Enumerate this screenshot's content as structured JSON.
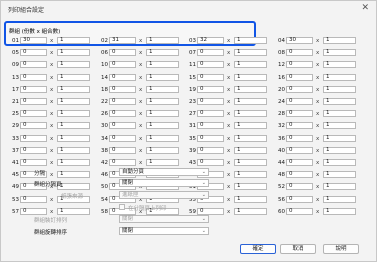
{
  "window": {
    "title": "列印組合設定",
    "close_glyph": "✕"
  },
  "group_header": "群組 (份數 x 組合數)",
  "multiplier": "x",
  "groups": [
    {
      "n": "01",
      "v": "30",
      "c": "1"
    },
    {
      "n": "02",
      "v": "31",
      "c": "1"
    },
    {
      "n": "03",
      "v": "32",
      "c": "1"
    },
    {
      "n": "04",
      "v": "30",
      "c": "1"
    },
    {
      "n": "05",
      "v": "0",
      "c": "1"
    },
    {
      "n": "06",
      "v": "0",
      "c": "1"
    },
    {
      "n": "07",
      "v": "0",
      "c": "1"
    },
    {
      "n": "08",
      "v": "0",
      "c": "1"
    },
    {
      "n": "09",
      "v": "0",
      "c": "1"
    },
    {
      "n": "10",
      "v": "0",
      "c": "1"
    },
    {
      "n": "11",
      "v": "0",
      "c": "1"
    },
    {
      "n": "12",
      "v": "0",
      "c": "1"
    },
    {
      "n": "13",
      "v": "0",
      "c": "1"
    },
    {
      "n": "14",
      "v": "0",
      "c": "1"
    },
    {
      "n": "15",
      "v": "0",
      "c": "1"
    },
    {
      "n": "16",
      "v": "0",
      "c": "1"
    },
    {
      "n": "17",
      "v": "0",
      "c": "1"
    },
    {
      "n": "18",
      "v": "0",
      "c": "1"
    },
    {
      "n": "19",
      "v": "0",
      "c": "1"
    },
    {
      "n": "20",
      "v": "0",
      "c": "1"
    },
    {
      "n": "21",
      "v": "0",
      "c": "1"
    },
    {
      "n": "22",
      "v": "0",
      "c": "1"
    },
    {
      "n": "23",
      "v": "0",
      "c": "1"
    },
    {
      "n": "24",
      "v": "0",
      "c": "1"
    },
    {
      "n": "25",
      "v": "0",
      "c": "1"
    },
    {
      "n": "26",
      "v": "0",
      "c": "1"
    },
    {
      "n": "27",
      "v": "0",
      "c": "1"
    },
    {
      "n": "28",
      "v": "0",
      "c": "1"
    },
    {
      "n": "29",
      "v": "0",
      "c": "1"
    },
    {
      "n": "30",
      "v": "0",
      "c": "1"
    },
    {
      "n": "31",
      "v": "0",
      "c": "1"
    },
    {
      "n": "32",
      "v": "0",
      "c": "1"
    },
    {
      "n": "33",
      "v": "0",
      "c": "1"
    },
    {
      "n": "34",
      "v": "0",
      "c": "1"
    },
    {
      "n": "35",
      "v": "0",
      "c": "1"
    },
    {
      "n": "36",
      "v": "0",
      "c": "1"
    },
    {
      "n": "37",
      "v": "0",
      "c": "1"
    },
    {
      "n": "38",
      "v": "0",
      "c": "1"
    },
    {
      "n": "39",
      "v": "0",
      "c": "1"
    },
    {
      "n": "40",
      "v": "0",
      "c": "1"
    },
    {
      "n": "41",
      "v": "0",
      "c": "1"
    },
    {
      "n": "42",
      "v": "0",
      "c": "1"
    },
    {
      "n": "43",
      "v": "0",
      "c": "1"
    },
    {
      "n": "44",
      "v": "0",
      "c": "1"
    },
    {
      "n": "45",
      "v": "0",
      "c": "1"
    },
    {
      "n": "46",
      "v": "0",
      "c": "1"
    },
    {
      "n": "47",
      "v": "0",
      "c": "1"
    },
    {
      "n": "48",
      "v": "0",
      "c": "1"
    },
    {
      "n": "49",
      "v": "0",
      "c": "1"
    },
    {
      "n": "50",
      "v": "0",
      "c": "1"
    },
    {
      "n": "51",
      "v": "0",
      "c": "1"
    },
    {
      "n": "52",
      "v": "0",
      "c": "1"
    },
    {
      "n": "53",
      "v": "0",
      "c": "1"
    },
    {
      "n": "54",
      "v": "0",
      "c": "1"
    },
    {
      "n": "55",
      "v": "0",
      "c": "1"
    },
    {
      "n": "56",
      "v": "0",
      "c": "1"
    },
    {
      "n": "57",
      "v": "0",
      "c": "1"
    },
    {
      "n": "58",
      "v": "0",
      "c": "1"
    },
    {
      "n": "59",
      "v": "0",
      "c": "1"
    },
    {
      "n": "60",
      "v": "0",
      "c": "1"
    }
  ],
  "settings": {
    "split_label": "分隔",
    "split_value": "自動分頁",
    "group_page_label": "群組分隔頁",
    "group_page_value": "關閉",
    "source_label": "紙張來源",
    "source_value": "進紙匣",
    "print_on_sep_label": "在分隔頁上列印",
    "group_staple_label": "群組裝訂排列",
    "group_staple_value": "關閉",
    "group_rotate_label": "群組旋轉排序",
    "group_rotate_value": "關閉"
  },
  "buttons": {
    "ok": "確定",
    "cancel": "取消",
    "help": "說明"
  },
  "icons": {
    "chevron": "chevron-down-icon",
    "close": "close-icon"
  },
  "colors": {
    "highlight": "#1155e6",
    "primary_border": "#2a62d6"
  }
}
